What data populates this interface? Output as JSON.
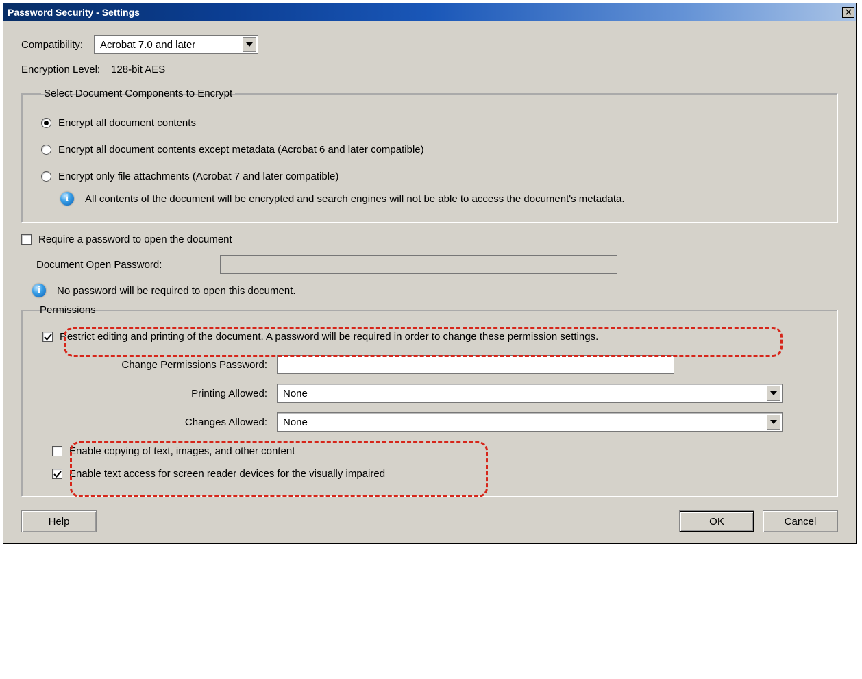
{
  "window": {
    "title": "Password Security - Settings"
  },
  "compat": {
    "label": "Compatibility:",
    "value": "Acrobat 7.0 and later"
  },
  "encryption": {
    "label": "Encryption  Level:",
    "value": "128-bit AES"
  },
  "encryptGroup": {
    "legend": "Select Document Components to Encrypt",
    "opt1": "Encrypt all document contents",
    "opt2": "Encrypt all document contents except metadata (Acrobat 6 and later compatible)",
    "opt3": "Encrypt only file attachments (Acrobat 7 and later compatible)",
    "info": "All contents of the document will be encrypted and search engines will not be able to access the document's metadata."
  },
  "open": {
    "require_label": "Require a password to open the document",
    "pw_label": "Document Open Password:",
    "pw_value": "",
    "info": "No password will be required to open this document."
  },
  "perm": {
    "legend": "Permissions",
    "restrict_label": "Restrict editing and printing of the document. A password will be required in order to change these permission settings.",
    "change_pw_label": "Change Permissions Password:",
    "change_pw_value": "",
    "printing_label": "Printing Allowed:",
    "printing_value": "None",
    "changes_label": "Changes Allowed:",
    "changes_value": "None",
    "copy_label": "Enable copying of text, images, and other content",
    "screenreader_label": "Enable text access for screen reader devices for the visually impaired"
  },
  "buttons": {
    "help": "Help",
    "ok": "OK",
    "cancel": "Cancel"
  }
}
